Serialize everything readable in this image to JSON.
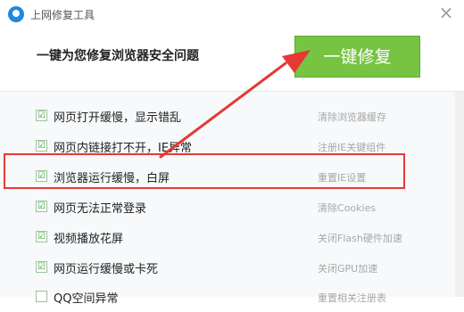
{
  "window": {
    "title": "上网修复工具",
    "close_symbol": "×"
  },
  "header": {
    "heading": "一键为您修复浏览器安全问题",
    "fix_button": "一键修复"
  },
  "issues": [
    {
      "label": "网页打开缓慢，显示错乱",
      "action": "清除浏览器缓存",
      "checked": true,
      "check": "☑"
    },
    {
      "label": "网页内链接打不开，IE异常",
      "action": "注册IE关键组件",
      "checked": true,
      "check": "☑"
    },
    {
      "label": "浏览器运行缓慢，白屏",
      "action": "重置IE设置",
      "checked": true,
      "check": "☑"
    },
    {
      "label": "网页无法正常登录",
      "action": "清除Cookies",
      "checked": true,
      "check": "☑"
    },
    {
      "label": "视频播放花屏",
      "action": "关闭Flash硬件加速",
      "checked": true,
      "check": "☑"
    },
    {
      "label": "网页运行缓慢或卡死",
      "action": "关闭GPU加速",
      "checked": true,
      "check": "☑"
    },
    {
      "label": "QQ空间异常",
      "action": "重置相关注册表",
      "checked": false,
      "check": ""
    }
  ],
  "colors": {
    "accent_green": "#76c442",
    "highlight_red": "#e53935",
    "arrow_red": "#e53935"
  }
}
